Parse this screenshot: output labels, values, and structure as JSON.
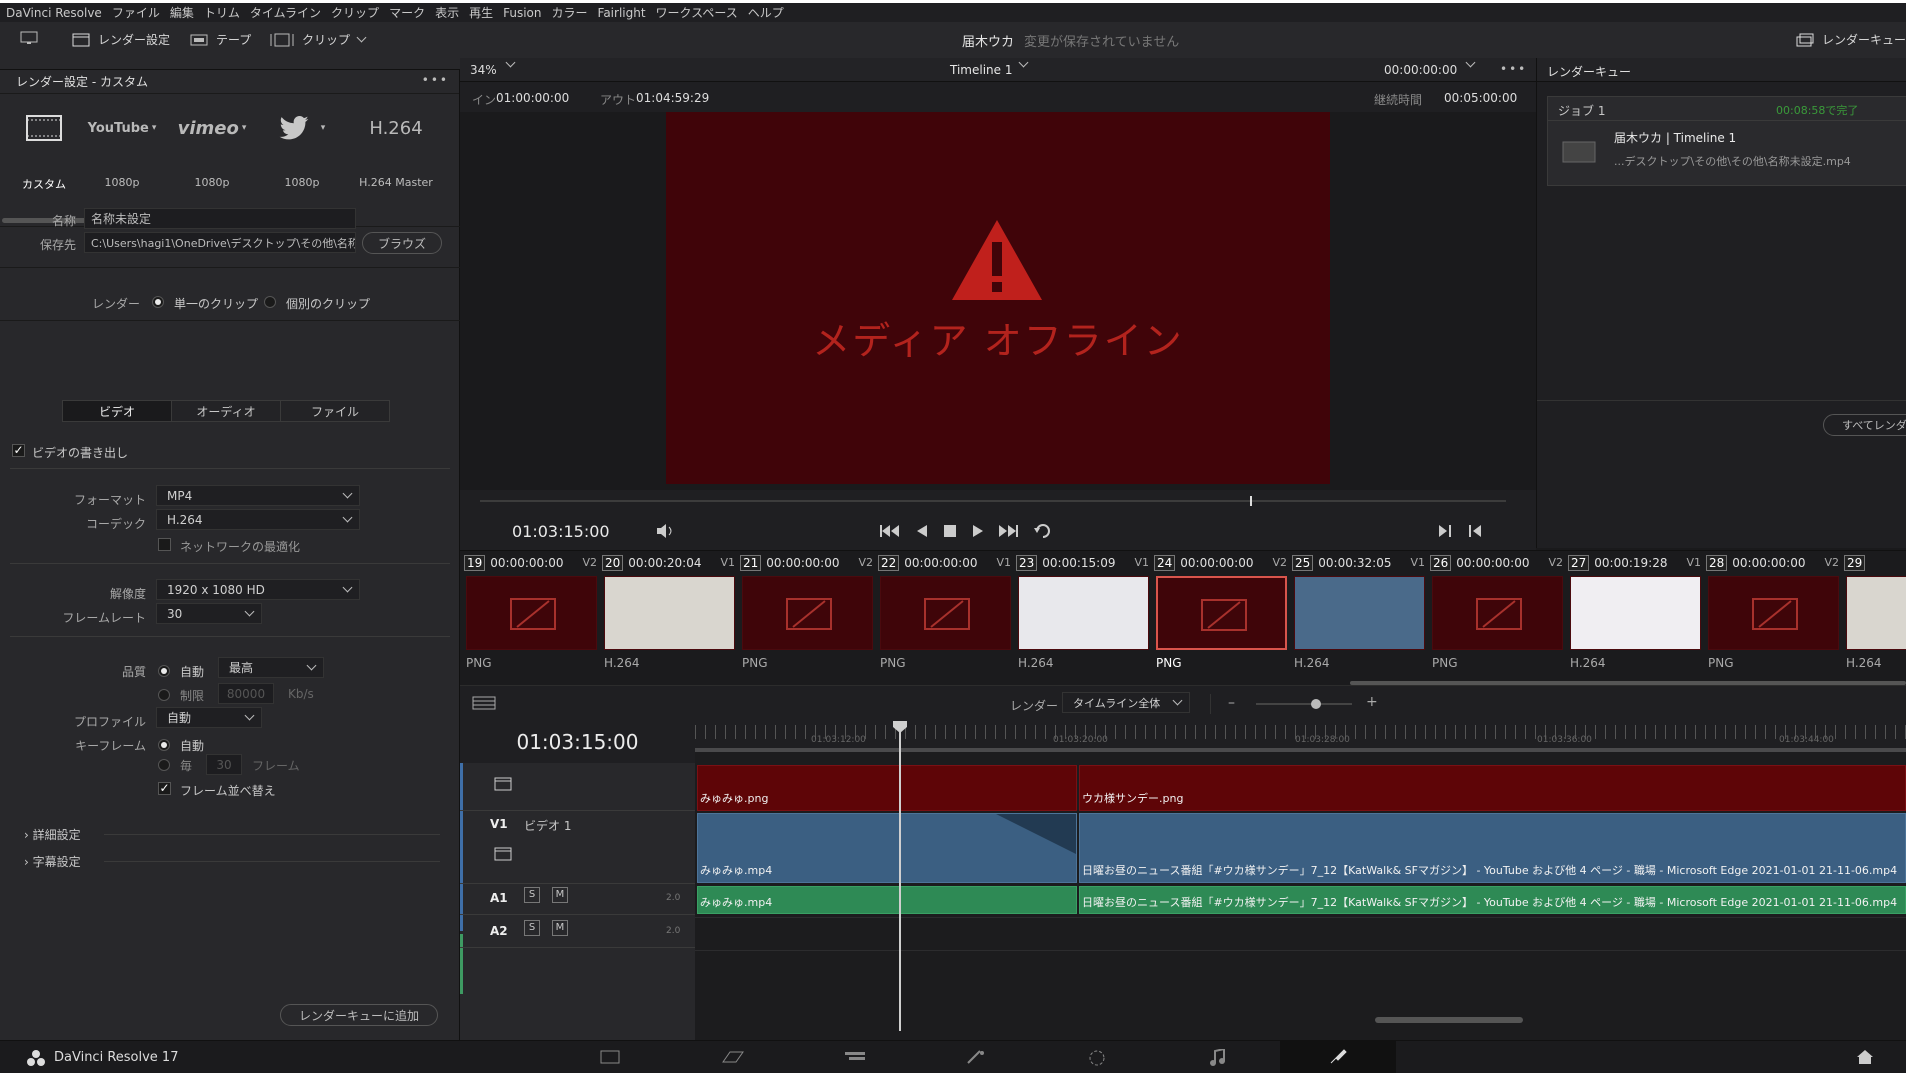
{
  "menubar": {
    "items": [
      "DaVinci Resolve",
      "ファイル",
      "編集",
      "トリム",
      "タイムライン",
      "クリップ",
      "マーク",
      "表示",
      "再生",
      "Fusion",
      "カラー",
      "Fairlight",
      "ワークスペース",
      "ヘルプ"
    ]
  },
  "toolbar": {
    "render_settings": "レンダー設定",
    "tape": "テープ",
    "clip": "クリップ",
    "project_name": "届木ウカ",
    "save_status": "変更が保存されていません",
    "render_queue": "レンダーキュー"
  },
  "left_panel": {
    "title": "レンダー設定 - カスタム",
    "presets": [
      {
        "label": "YouTube",
        "sub": "1080p",
        "icon": "youtube-icon"
      },
      {
        "label": "vimeo",
        "sub": "1080p",
        "icon": "vimeo-icon"
      },
      {
        "label": "twitter",
        "sub": "1080p",
        "icon": "twitter-icon"
      },
      {
        "label": "H.264",
        "sub": "H.264 Master",
        "icon": "h264-icon"
      }
    ],
    "custom_label": "カスタム",
    "name_label": "名称",
    "name_value": "名称未設定",
    "location_label": "保存先",
    "location_value": "C:\\Users\\hagi1\\OneDrive\\デスクトップ\\その他\\名称",
    "browse": "ブラウズ",
    "render_label": "レンダー",
    "single_clip": "単一のクリップ",
    "individual_clips": "個別のクリップ",
    "tabs": [
      "ビデオ",
      "オーディオ",
      "ファイル"
    ],
    "export_video": "ビデオの書き出し",
    "format_label": "フォーマット",
    "format_value": "MP4",
    "codec_label": "コーデック",
    "codec_value": "H.264",
    "network_opt": "ネットワークの最適化",
    "resolution_label": "解像度",
    "resolution_value": "1920 x 1080 HD",
    "framerate_label": "フレームレート",
    "framerate_value": "30",
    "quality_label": "品質",
    "quality_auto": "自動",
    "quality_value": "最高",
    "quality_limit": "制限",
    "quality_limit_value": "80000",
    "quality_unit": "Kb/s",
    "profile_label": "プロファイル",
    "profile_value": "自動",
    "keyframe_label": "キーフレーム",
    "keyframe_auto": "自動",
    "keyframe_every": "毎",
    "keyframe_every_value": "30",
    "keyframe_unit": "フレーム",
    "frame_reorder": "フレーム並べ替え",
    "advanced": "詳細設定",
    "subtitles": "字幕設定",
    "add_to_queue": "レンダーキューに追加"
  },
  "viewer": {
    "zoom": "34%",
    "timeline_name": "Timeline 1",
    "timecode_top": "00:00:00:00",
    "in_label": "イン",
    "in_value": "01:00:00:00",
    "out_label": "アウト",
    "out_value": "01:04:59:29",
    "duration_label": "継続時間",
    "duration_value": "00:05:00:00",
    "offline_text": "メディア オフライン",
    "current_tc": "01:03:15:00",
    "scrub_position": 0.75
  },
  "render_queue": {
    "title": "レンダーキュー",
    "job_title": "ジョブ 1",
    "job_status": "00:08:58で完了",
    "job_name": "届木ウカ | Timeline 1",
    "job_path": "...デスクトップ\\その他\\その他\\名称未設定.mp4",
    "render_all": "すべてレンダ"
  },
  "clips": [
    {
      "num": "19",
      "tc": "00:00:00:00",
      "track": "V2",
      "codec": "PNG",
      "offline": true
    },
    {
      "num": "20",
      "tc": "00:00:20:04",
      "track": "V1",
      "codec": "H.264",
      "offline": false
    },
    {
      "num": "21",
      "tc": "00:00:00:00",
      "track": "V2",
      "codec": "PNG",
      "offline": true
    },
    {
      "num": "22",
      "tc": "00:00:00:00",
      "track": "V1",
      "codec": "PNG",
      "offline": true
    },
    {
      "num": "23",
      "tc": "00:00:15:09",
      "track": "V1",
      "codec": "H.264",
      "offline": false
    },
    {
      "num": "24",
      "tc": "00:00:00:00",
      "track": "V2",
      "codec": "PNG",
      "offline": true
    },
    {
      "num": "25",
      "tc": "00:00:32:05",
      "track": "V1",
      "codec": "H.264",
      "offline": false
    },
    {
      "num": "26",
      "tc": "00:00:00:00",
      "track": "V2",
      "codec": "PNG",
      "offline": true
    },
    {
      "num": "27",
      "tc": "00:00:19:28",
      "track": "V1",
      "codec": "H.264",
      "offline": false
    },
    {
      "num": "28",
      "tc": "00:00:00:00",
      "track": "V2",
      "codec": "PNG",
      "offline": true
    },
    {
      "num": "29",
      "tc": "",
      "track": "",
      "codec": "H.264",
      "offline": false
    }
  ],
  "timeline": {
    "render_label": "レンダー",
    "render_value": "タイムライン全体",
    "timecode": "01:03:15:00",
    "ruler": [
      "01:03:12:00",
      "01:03:20:00",
      "01:03:28:00",
      "01:03:36:00",
      "01:03:44:00"
    ],
    "v1_label": "V1",
    "v1_name": "ビデオ 1",
    "a1_label": "A1",
    "a2_label": "A2",
    "s": "S",
    "m": "M",
    "ch": "2.0",
    "v2_clip1": "みゅみゅ.png",
    "v2_clip2": "ウカ様サンデー.png",
    "v1_clip1": "みゅみゅ.mp4",
    "v1_clip2": "日曜お昼のニュース番組「#ウカ様サンデー」7_12【KatWalk& SFマガジン】 - YouTube および他 4 ページ - 職場 - Microsoft Edge 2021-01-01 21-11-06.mp4",
    "a1_clip1": "みゅみゅ.mp4",
    "a1_clip2": "日曜お昼のニュース番組「#ウカ様サンデー」7_12【KatWalk& SFマガジン】 - YouTube および他 4 ページ - 職場 - Microsoft Edge 2021-01-01 21-11-06.mp4"
  },
  "bottom": {
    "app_name": "DaVinci Resolve 17"
  }
}
